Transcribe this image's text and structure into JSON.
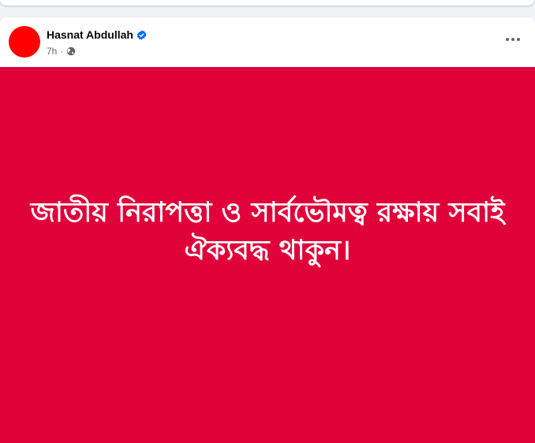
{
  "post": {
    "author": "Hasnat Abdullah",
    "verified": true,
    "timestamp": "7h",
    "privacy_icon": "globe-icon",
    "more_icon": "more-horizontal-icon",
    "avatar_color": "#ff0000",
    "verified_color": "#0866ff",
    "image": {
      "background_color": "#e0003a",
      "text_color": "#ffffff",
      "line1": "জাতীয় নিরাপত্তা ও সার্বভৌমত্ব রক্ষায় সবাই",
      "line2": "ঐক্যবদ্ধ থাকুন।"
    }
  }
}
